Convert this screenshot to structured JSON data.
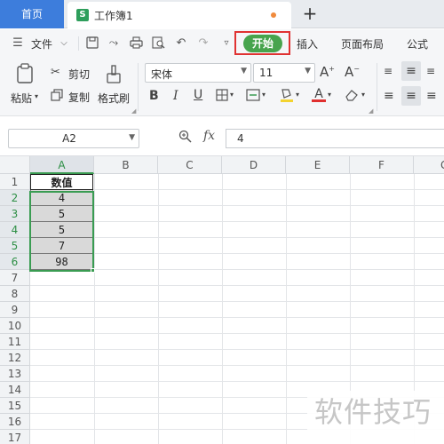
{
  "tabs": {
    "home_label": "首页",
    "doc_icon_letter": "S",
    "doc_title": "工作簿1",
    "new_tab_symbol": "+"
  },
  "menu": {
    "file_label": "文件",
    "start_label": "开始",
    "insert_label": "插入",
    "page_layout_label": "页面布局",
    "formula_label": "公式"
  },
  "ribbon": {
    "paste_label": "粘贴",
    "cut_label": "剪切",
    "copy_label": "复制",
    "format_painter_label": "格式刷",
    "font_name": "宋体",
    "font_size": "11"
  },
  "formula_bar": {
    "name_box": "A2",
    "fx_label": "fx",
    "content": "4"
  },
  "sheet": {
    "columns": [
      "A",
      "B",
      "C",
      "D",
      "E",
      "F",
      "G"
    ],
    "rows": [
      "1",
      "2",
      "3",
      "4",
      "5",
      "6",
      "7",
      "8",
      "9",
      "10",
      "11",
      "12",
      "13",
      "14",
      "15",
      "16",
      "17"
    ],
    "header_cell": "数值",
    "values": [
      "4",
      "5",
      "5",
      "7",
      "98"
    ]
  },
  "watermark": "软件技巧",
  "colors": {
    "home_tab": "#3d7ddc",
    "start_button": "#47a44d",
    "highlight_box": "#e03232",
    "selection": "#3a9c52",
    "selected_fill": "#d9d9d9"
  }
}
